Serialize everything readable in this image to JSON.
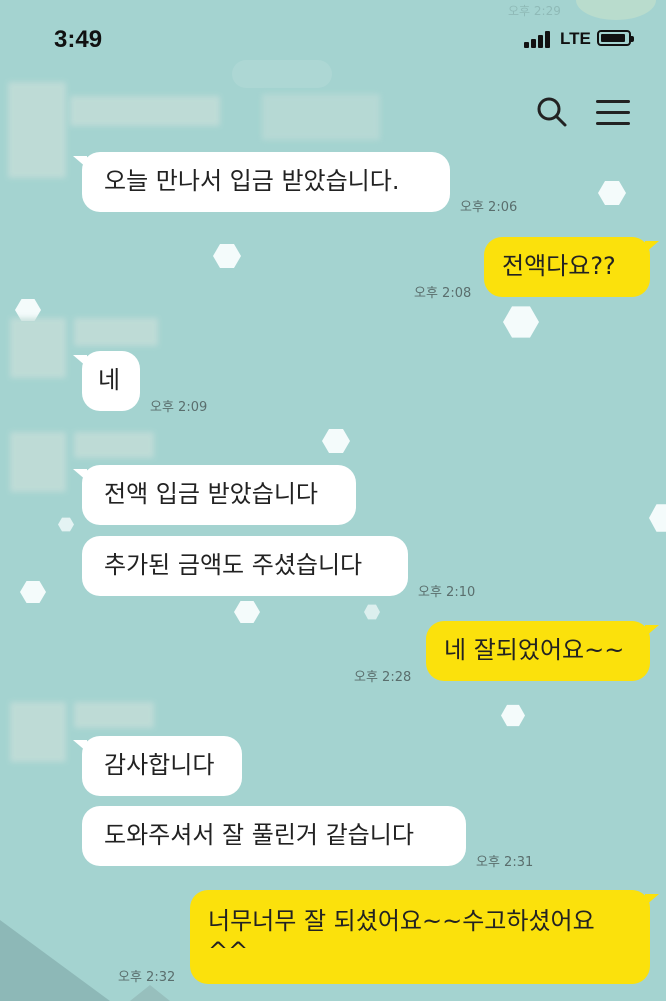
{
  "status": {
    "time": "3:49",
    "network": "LTE",
    "ghost_time": "오후 2:29"
  },
  "header": {
    "search_icon": "search-icon",
    "menu_icon": "hamburger-menu-icon"
  },
  "messages": [
    {
      "side": "in",
      "text": "오늘 만나서 입금 받았습니다.",
      "time": "오후 2:06"
    },
    {
      "side": "out",
      "text": "전액다요??",
      "time": "오후 2:08"
    },
    {
      "side": "in",
      "text": "네",
      "time": "오후 2:09"
    },
    {
      "side": "in",
      "text": "전액 입금 받았습니다",
      "time": ""
    },
    {
      "side": "in",
      "text": "추가된 금액도 주셨습니다",
      "time": "오후 2:10"
    },
    {
      "side": "out",
      "text": "네 잘되었어요~~",
      "time": "오후 2:28"
    },
    {
      "side": "in",
      "text": "감사합니다",
      "time": ""
    },
    {
      "side": "in",
      "text": "도와주셔서 잘 풀린거 같습니다",
      "time": "오후 2:31"
    },
    {
      "side": "out",
      "text": "너무너무 잘 되셨어요~~수고하셨어요\n^^",
      "time": "오후 2:32"
    }
  ],
  "colors": {
    "background": "#a4d3d0",
    "incoming_bubble": "#ffffff",
    "outgoing_bubble": "#fbe10c"
  }
}
